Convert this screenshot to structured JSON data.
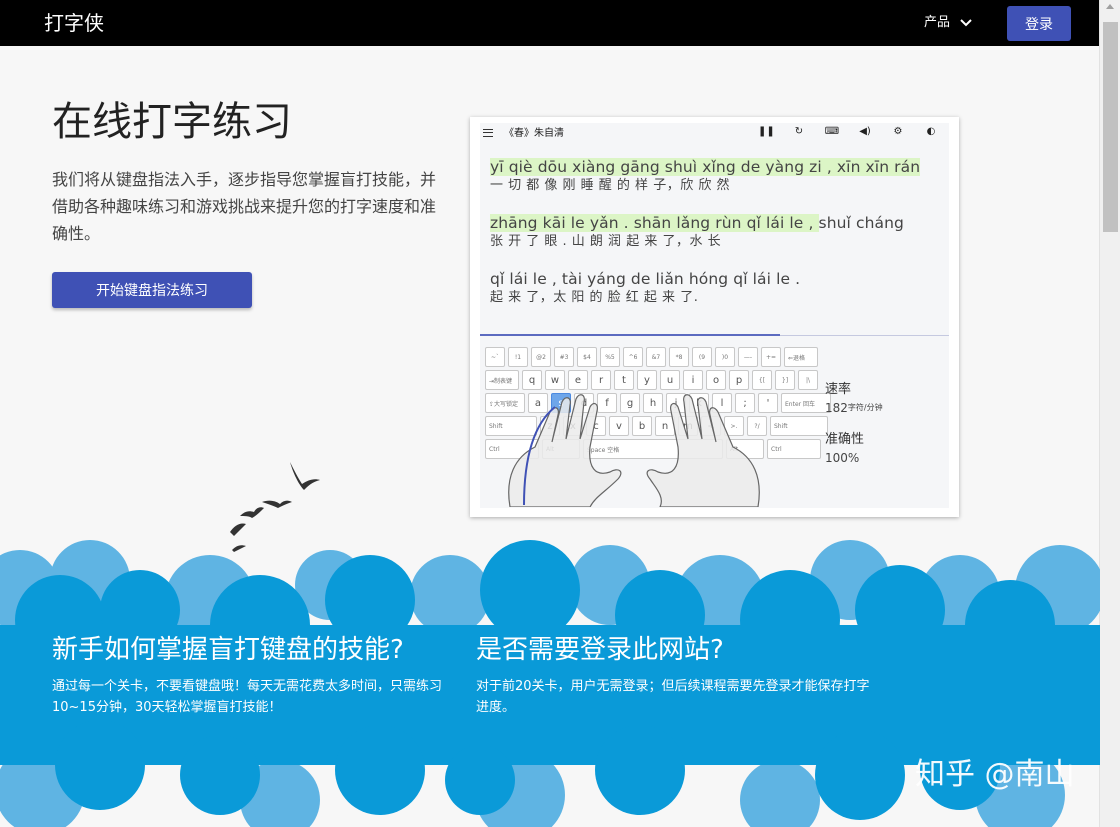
{
  "header": {
    "brand": "打字侠",
    "product_menu": "产品",
    "login": "登录"
  },
  "hero": {
    "title": "在线打字练习",
    "description": "我们将从键盘指法入手，逐步指导您掌握盲打技能，并借助各种趣味练习和游戏挑战来提升您的打字速度和准确性。",
    "cta": "开始键盘指法练习"
  },
  "preview": {
    "article_title": "《春》朱自清",
    "toolbar_icons": [
      "pause-icon",
      "restart-icon",
      "keyboard-icon",
      "volume-icon",
      "settings-icon",
      "theme-icon"
    ],
    "lines": [
      {
        "pinyin_done": "yī qiè dōu xiàng gāng shuì xǐng de yàng zi , xīn xīn rán",
        "pinyin_todo": "",
        "hanzi": "一 切 都 像 刚 睡 醒 的 样 子，欣 欣 然"
      },
      {
        "pinyin_done": "zhāng kāi le yǎn . shān lǎng rùn qǐ lái le , ",
        "pinyin_todo": "shuǐ cháng",
        "hanzi": "张 开 了 眼 . 山 朗 润 起 来 了，水 长"
      },
      {
        "pinyin_done": "",
        "pinyin_todo": "qǐ lái le , tài yáng de liǎn hóng qǐ lái le .",
        "hanzi": "起 来 了，太 阳 的 脸 红 起 来 了."
      }
    ],
    "progress": 0.64,
    "stats": {
      "speed_label": "速率",
      "speed_value": "182",
      "speed_unit": "字符/分钟",
      "accuracy_label": "准确性",
      "accuracy_value": "100%"
    },
    "keyboard": {
      "row1": [
        "~`",
        "!1",
        "@2",
        "#3",
        "$4",
        "%5",
        "^6",
        "&7",
        "*8",
        "(9",
        ")0",
        "—-",
        "+="
      ],
      "row1_end": "⇐退格",
      "row2_start": "⇥制表键",
      "row2": [
        "q",
        "w",
        "e",
        "r",
        "t",
        "y",
        "u",
        "i",
        "o",
        "p",
        "{[",
        "}]",
        "|\\"
      ],
      "row3_start": "⇪大写锁定",
      "row3": [
        "a",
        "s",
        "d",
        "f",
        "g",
        "h",
        "j",
        "k",
        "l",
        ";",
        "'"
      ],
      "row3_end": "Enter 回车",
      "row4_start": "Shift",
      "row4": [
        "z",
        "x",
        "c",
        "v",
        "b",
        "n",
        "m",
        "<,",
        ">.",
        "?/"
      ],
      "row4_end": "Shift",
      "row5": [
        "Ctrl",
        "Alt",
        "Space 空格",
        "Alt",
        "Ctrl"
      ],
      "active_key": "s"
    }
  },
  "faq": [
    {
      "title": "新手如何掌握盲打键盘的技能?",
      "text": "通过每一个关卡，不要看键盘哦！每天无需花费太多时间，只需练习10~15分钟，30天轻松掌握盲打技能！"
    },
    {
      "title": "是否需要登录此网站?",
      "text": "对于前20关卡，用户无需登录；但后续课程需要先登录才能保存打字进度。"
    }
  ],
  "watermark": "知乎 @南山",
  "colors": {
    "primary": "#3f51b5",
    "cloud_dark": "#0a9ad8",
    "cloud_light": "#5fb4e3",
    "typed_bg": "#dcf5c6",
    "current_bg": "#fde0a7"
  }
}
